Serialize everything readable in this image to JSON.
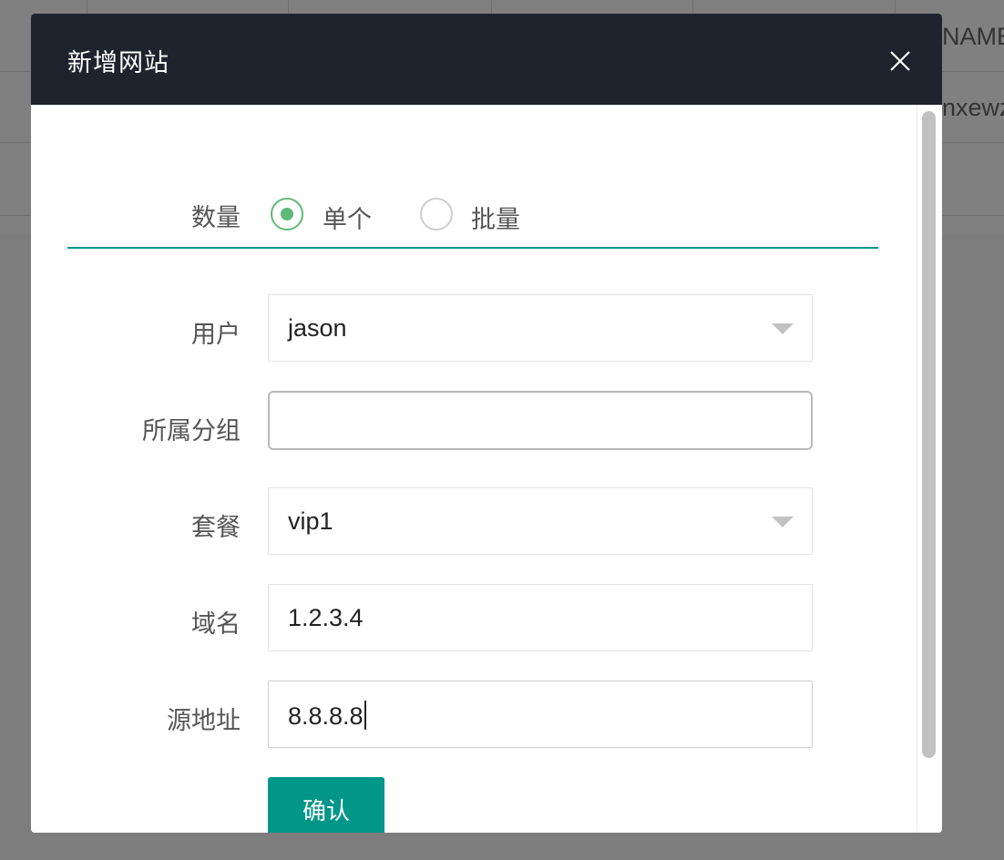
{
  "background_table": {
    "header_fragment": "NAME",
    "row_fragment": "nxewz"
  },
  "modal": {
    "title": "新增网站",
    "close_icon": "close-icon"
  },
  "form": {
    "quantity": {
      "label": "数量",
      "options": [
        "单个",
        "批量"
      ],
      "selected": "单个"
    },
    "user": {
      "label": "用户",
      "value": "jason"
    },
    "group": {
      "label": "所属分组",
      "value": ""
    },
    "package": {
      "label": "套餐",
      "value": "vip1"
    },
    "domain": {
      "label": "域名",
      "value": "1.2.3.4"
    },
    "source": {
      "label": "源地址",
      "value": "8.8.8.8"
    },
    "confirm_label": "确认"
  },
  "colors": {
    "accent": "#009688",
    "radio_checked": "#5fb878",
    "header_bg": "#1f232e"
  }
}
